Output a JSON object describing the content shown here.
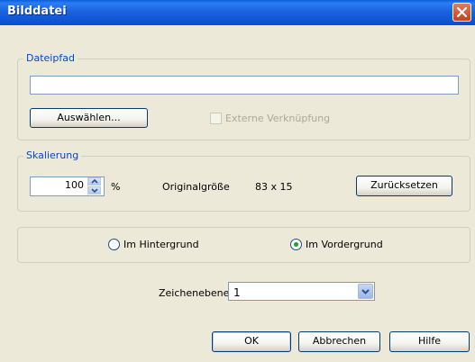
{
  "window": {
    "title": "Bilddatei"
  },
  "file_group": {
    "legend": "Dateipfad",
    "path_value": "",
    "browse_label": "Auswählen...",
    "external_link_label": "Externe Verknüpfung",
    "external_link_checked": false
  },
  "scaling_group": {
    "legend": "Skalierung",
    "scale_value": "100",
    "percent_symbol": "%",
    "original_size_label": "Originalgröße",
    "original_size_value": "83 x 15",
    "reset_label": "Zurücksetzen"
  },
  "position_group": {
    "background_label": "Im Hintergrund",
    "foreground_label": "Im Vordergrund",
    "selected": "foreground"
  },
  "layer": {
    "label": "Zeichenebene",
    "value": "1"
  },
  "buttons": {
    "ok": "OK",
    "cancel": "Abbrechen",
    "help": "Hilfe"
  },
  "icons": {
    "close": "close-icon",
    "spin_up": "spin-up-icon",
    "spin_down": "spin-down-icon",
    "dropdown": "chevron-down-icon"
  },
  "colors": {
    "titlebar": "#0b4fc7",
    "legend_text": "#0046d5",
    "window_bg": "#ece9d8",
    "radio_dot": "#21a121"
  }
}
